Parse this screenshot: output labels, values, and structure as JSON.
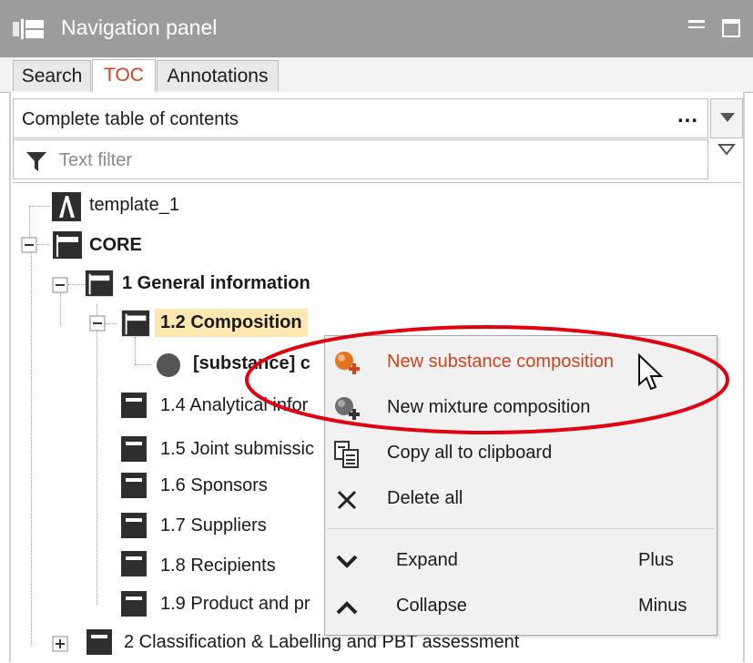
{
  "window": {
    "title": "Navigation panel",
    "minimize_icon": "minimize-icon",
    "maximize_icon": "maximize-icon"
  },
  "tabs": [
    {
      "label": "Search"
    },
    {
      "label": "TOC"
    },
    {
      "label": "Annotations"
    }
  ],
  "toc_select": {
    "value": "Complete table of contents",
    "more": "...",
    "icon": "chevron-down-icon"
  },
  "filter": {
    "placeholder": "Text filter",
    "icon": "filter-funnel-icon"
  },
  "tree": {
    "template": "template_1",
    "core": "CORE",
    "general": "1 General information",
    "composition": "1.2 Composition",
    "substance": "[substance] c",
    "items": [
      "1.4 Analytical infor",
      "1.5 Joint submissic",
      "1.6 Sponsors",
      "1.7 Suppliers",
      "1.8 Recipients",
      "1.9 Product and pr"
    ],
    "classification": "2 Classification & Labelling and PBT assessment"
  },
  "context_menu": {
    "new_substance": "New substance composition",
    "new_mixture": "New mixture composition",
    "copy_all": "Copy all to clipboard",
    "delete_all": "Delete all",
    "expand": "Expand",
    "expand_shortcut": "Plus",
    "collapse": "Collapse",
    "collapse_shortcut": "Minus"
  },
  "colors": {
    "accent": "#d0421b",
    "selection": "#fde7b0",
    "annotation_ellipse": "#e0000f"
  }
}
